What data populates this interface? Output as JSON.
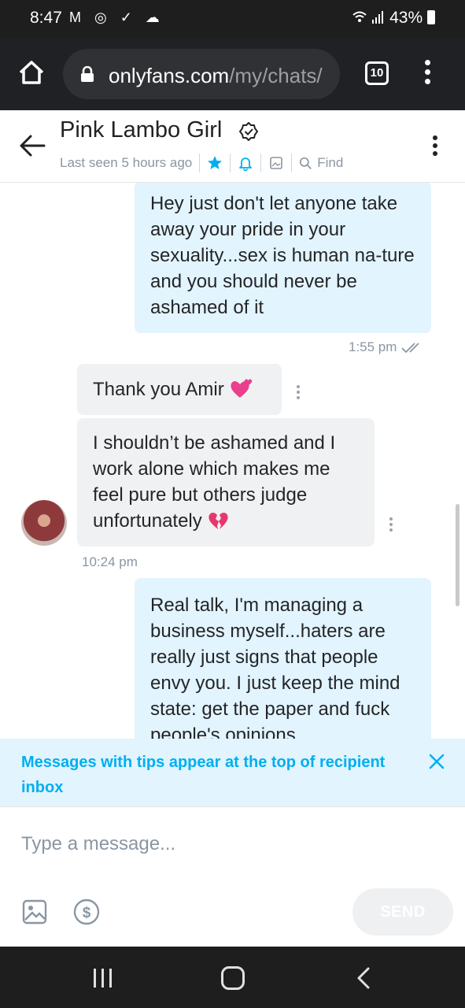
{
  "status_bar": {
    "time": "8:47",
    "notif_icons": "M ◎ ✓ ☁",
    "battery": "43%"
  },
  "browser": {
    "url_domain": "onlyfans.com",
    "url_path": "/my/chats/",
    "tab_count": "10"
  },
  "chat": {
    "name": "Pink Lambo Girl",
    "last_seen": "Last seen 5 hours ago",
    "find_label": "Find"
  },
  "messages": [
    {
      "direction": "outgoing",
      "text": "Hey just don't let anyone take away your pride in your sexuality...sex is human na-ture and you should never be ashamed of it",
      "time": "1:55 pm"
    },
    {
      "direction": "incoming",
      "text": "Thank you Amir",
      "emoji": "two-hearts"
    },
    {
      "direction": "incoming",
      "text": "I shouldn’t be ashamed and I work alone which makes me feel pure but others judge unfortunately",
      "emoji": "broken-heart",
      "time": "10:24 pm"
    },
    {
      "direction": "outgoing",
      "text": "Real talk, I'm managing a business myself...haters are really just signs that people envy you. I just keep the mind state: get the paper and fuck people's opinions"
    }
  ],
  "tip_banner": {
    "text": "Messages with tips appear at the top of recipient inbox"
  },
  "composer": {
    "placeholder": "Type a message...",
    "send_label": "SEND"
  },
  "colors": {
    "brand_blue": "#00aff0",
    "outgoing_bubble": "#e2f4fd",
    "incoming_bubble": "#f0f1f2",
    "muted_text": "#8a96a3"
  }
}
